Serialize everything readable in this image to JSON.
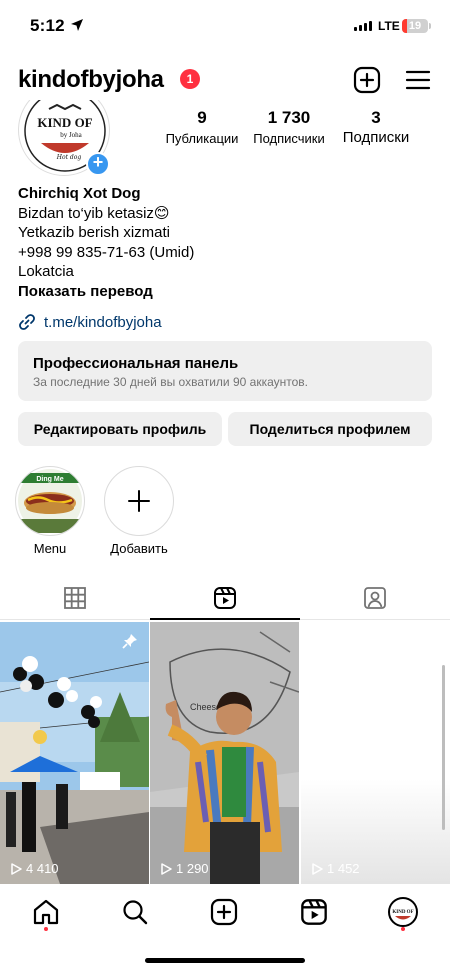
{
  "status_bar": {
    "time": "5:12",
    "network": "LTE",
    "battery": "19",
    "battery_level": 0.19
  },
  "header": {
    "username": "kindofbyjoha",
    "notification_count": "1"
  },
  "avatar": {
    "logo_text": "KIND OF",
    "logo_sub": "by Joha",
    "logo_script": "Hot dog"
  },
  "stats": [
    {
      "value": "9",
      "label": "Публикации"
    },
    {
      "value": "1 730",
      "label": "Подписчики"
    },
    {
      "value": "3",
      "label": "Подписки"
    }
  ],
  "bio": {
    "name": "Chirchiq Xot Dog",
    "lines": [
      "Bizdan to‘yib ketasiz😊",
      "Yetkazib berish xizmati",
      "+998 99 835-71-63 (Umid)",
      "Lokatcia"
    ],
    "translate": "Показать перевод",
    "link": "t.me/kindofbyjoha"
  },
  "pro_panel": {
    "title": "Профессиональная панель",
    "subtitle": "За последние 30 дней вы охватили 90 аккаунтов."
  },
  "buttons": {
    "edit": "Редактировать профиль",
    "share": "Поделиться профилем"
  },
  "highlights": [
    {
      "label": "Menu",
      "cover_text": "Ding Me"
    },
    {
      "label": "Добавить"
    }
  ],
  "posts": [
    {
      "views": "4 410",
      "pinned": true
    },
    {
      "views": "1 290",
      "sign_text": "Cheese"
    },
    {
      "views": "1 452"
    }
  ],
  "colors": {
    "accent_blue": "#3897f0",
    "badge_red": "#ff3040",
    "link": "#00376b"
  }
}
